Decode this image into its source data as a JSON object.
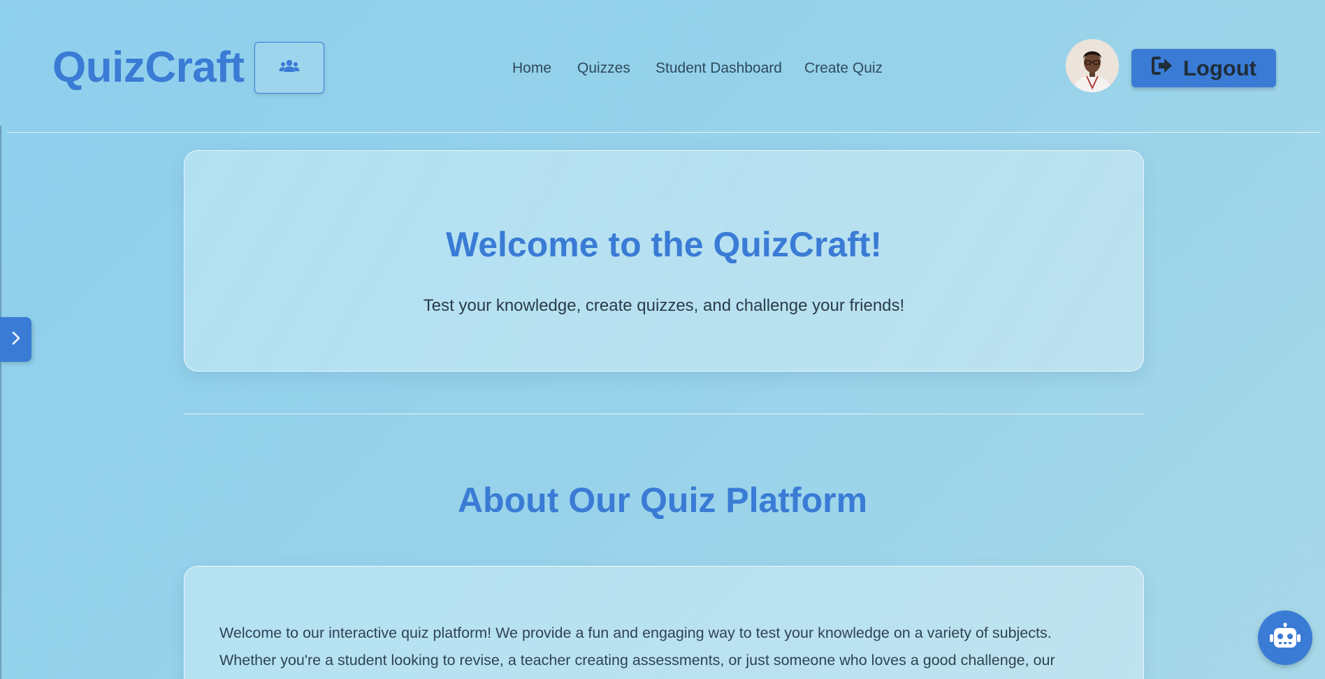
{
  "header": {
    "logo": "QuizCraft",
    "nav": [
      {
        "label": "Home"
      },
      {
        "label": "Quizzes"
      },
      {
        "label": "Student Dashboard"
      },
      {
        "label": "Create Quiz"
      }
    ],
    "logout_label": "Logout",
    "group_icon": "users-icon",
    "logout_icon": "sign-out-icon"
  },
  "hero": {
    "title": "Welcome to the QuizCraft!",
    "subtitle": "Test your knowledge, create quizzes, and challenge your friends!"
  },
  "about": {
    "title": "About Our Quiz Platform",
    "line1": "Welcome to our interactive quiz platform! We provide a fun and engaging way to test your knowledge on a variety of subjects.",
    "line2": "Whether you're a student looking to revise, a teacher creating assessments, or just someone who loves a good challenge, our"
  },
  "floating": {
    "sidebar_toggle_icon": "chevron-right-icon",
    "chatbot_icon": "robot-icon"
  },
  "colors": {
    "accent": "#3a7bd5",
    "background": "#97d2ea",
    "text": "#2c3e50"
  }
}
